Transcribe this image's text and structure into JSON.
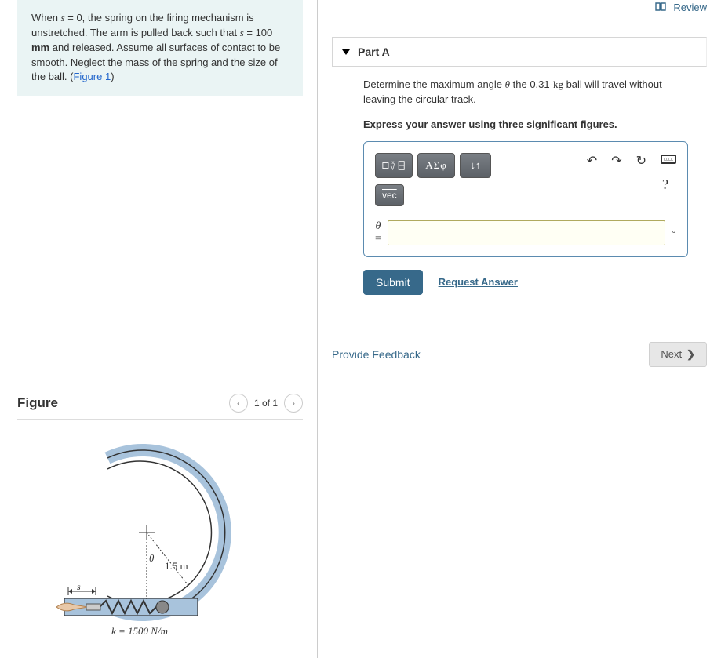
{
  "header": {
    "review": "Review"
  },
  "problem": {
    "text_prefix": "When ",
    "s_var": "s",
    "eq0": " = 0, the spring on the firing mechanism is unstretched. The arm is pulled back such that ",
    "eq100": " = 100 ",
    "mm": "mm",
    "text_mid": " and released. Assume all surfaces of contact to be smooth. Neglect the mass of the spring and the size of the ball. (",
    "figure_link": "Figure 1",
    "text_end": ")"
  },
  "figure": {
    "title": "Figure",
    "counter": "1 of 1",
    "radius_label": "1.5 m",
    "theta_label": "θ",
    "s_label": "s",
    "k_label": "k = 1500 N/m"
  },
  "part": {
    "label": "Part A",
    "prompt_prefix": "Determine the maximum angle ",
    "theta": "θ",
    "prompt_mid": " the 0.31-",
    "kg": "kg",
    "prompt_end": " ball will travel without leaving the circular track.",
    "instruction": "Express your answer using three significant figures.",
    "greek_btn": "ΑΣφ",
    "arrows_btn": "↓↑",
    "vec_btn": "vec",
    "var_line1": "θ",
    "var_line2": "=",
    "unit": "∘",
    "submit": "Submit",
    "request": "Request Answer"
  },
  "footer": {
    "feedback": "Provide Feedback",
    "next": "Next"
  }
}
